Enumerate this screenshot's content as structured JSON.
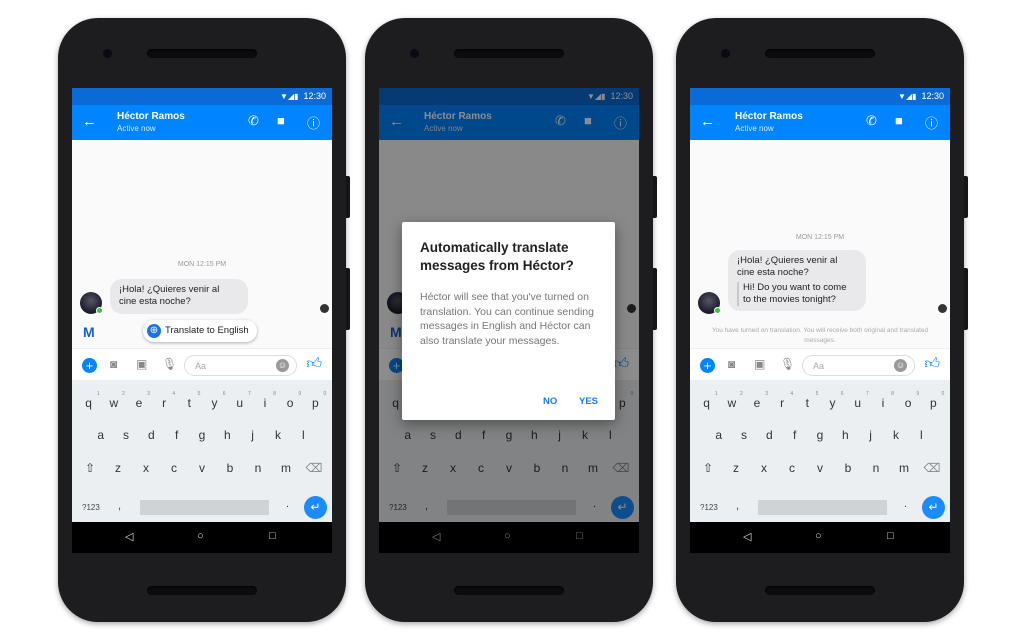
{
  "status": {
    "time": "12:30"
  },
  "contact": {
    "name": "Héctor Ramos",
    "presence": "Active now"
  },
  "chat": {
    "timestamp": "MON 12:15 PM",
    "original": "¡Hola! ¿Quieres venir al cine esta noche?",
    "translated": "Hi! Do you want to come to the movies tonight?",
    "translate_chip": "Translate to English",
    "notice": "You have turned on translation. You will receive both original and translated messages."
  },
  "composer": {
    "placeholder": "Aa"
  },
  "keyboard": {
    "row1": [
      "q",
      "w",
      "e",
      "r",
      "t",
      "y",
      "u",
      "i",
      "o",
      "p"
    ],
    "row1_hints": [
      "1",
      "2",
      "3",
      "4",
      "5",
      "6",
      "7",
      "8",
      "9",
      "0"
    ],
    "row2": [
      "a",
      "s",
      "d",
      "f",
      "g",
      "h",
      "j",
      "k",
      "l"
    ],
    "row3": [
      "z",
      "x",
      "c",
      "v",
      "b",
      "n",
      "m"
    ],
    "symbols": "?123",
    "comma": ",",
    "period": "."
  },
  "dialog": {
    "title": "Automatically translate messages from Héctor?",
    "body": "Héctor will see that you've turned on translation. You can continue sending messages in English and Héctor can also translate your messages.",
    "no": "NO",
    "yes": "YES"
  },
  "colors": {
    "brand": "#0084ff",
    "status_bar": "#0a6bd6"
  },
  "phones": [
    {
      "state": "translate-prompt"
    },
    {
      "state": "dialog"
    },
    {
      "state": "translated"
    }
  ]
}
